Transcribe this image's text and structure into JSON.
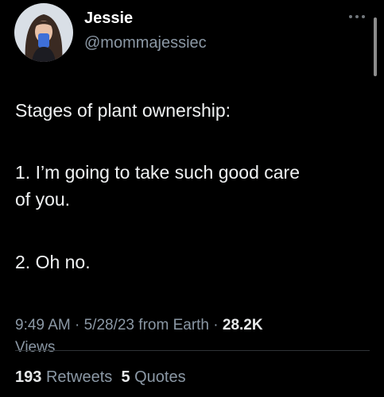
{
  "author": {
    "display_name": "Jessie",
    "handle": "@mommajessiec",
    "avatar_icon": "profile-photo-avatar"
  },
  "more_icon": "ellipsis-icon",
  "tweet": {
    "lines": [
      "Stages of plant ownership:",
      "1. I’m going to take such good care",
      "of you.",
      "2. Oh no."
    ]
  },
  "meta": {
    "time": "9:49 AM",
    "sep1": "·",
    "date": "5/28/23",
    "source": "from Earth",
    "sep2": "·",
    "views_count": "28.2K",
    "views_label": "Views"
  },
  "stats": {
    "retweets_count": "193",
    "retweets_label": "Retweets",
    "quotes_count": "5",
    "quotes_label": "Quotes"
  }
}
